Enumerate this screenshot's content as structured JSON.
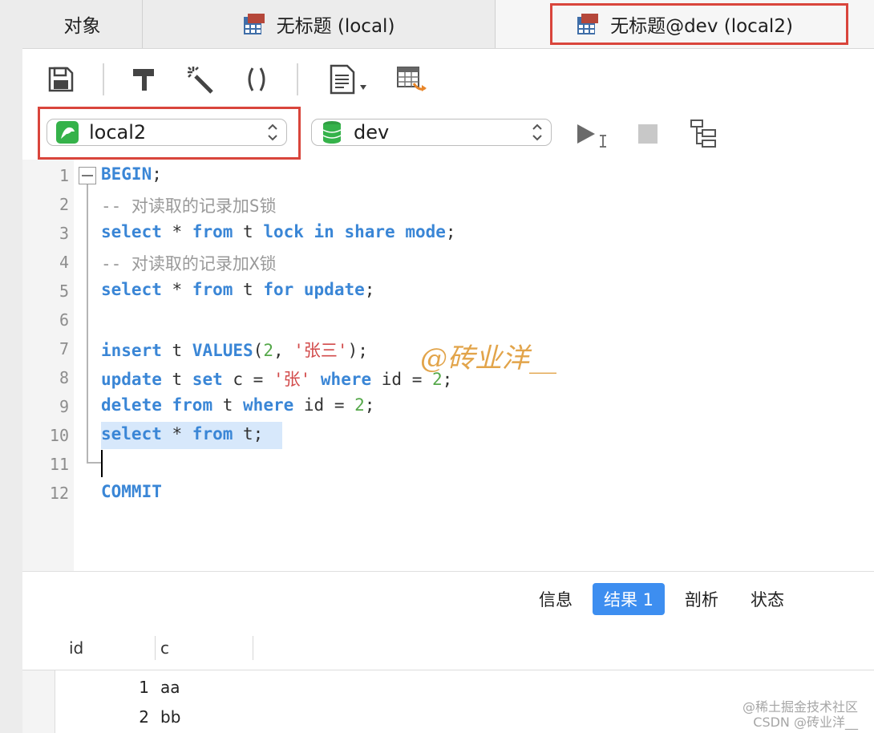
{
  "tabs": {
    "objects": "对象",
    "tab1": "无标题 (local)",
    "tab2": "无标题@dev (local2)"
  },
  "toolbar": {
    "icons": [
      "save-icon",
      "format-hammer-icon",
      "beautify-wand-icon",
      "parentheses-icon",
      "snippet-document-icon",
      "table-export-icon"
    ]
  },
  "connection": {
    "selected": "local2",
    "database": "dev",
    "icons": [
      "run-icon",
      "stop-icon",
      "explain-plan-icon"
    ]
  },
  "editor": {
    "line_numbers": [
      "1",
      "2",
      "3",
      "4",
      "5",
      "6",
      "7",
      "8",
      "9",
      "10",
      "11",
      "12"
    ],
    "lines": [
      {
        "n": "1",
        "tokens": [
          {
            "t": "BEGIN",
            "k": "kw"
          },
          {
            "t": ";",
            "k": "p"
          }
        ]
      },
      {
        "n": "2",
        "tokens": [
          {
            "t": "-- 对读取的记录加S锁",
            "k": "cm"
          }
        ]
      },
      {
        "n": "3",
        "tokens": [
          {
            "t": "select",
            "k": "kw"
          },
          {
            "t": " * ",
            "k": "p"
          },
          {
            "t": "from",
            "k": "kw"
          },
          {
            "t": " t ",
            "k": "p"
          },
          {
            "t": "lock in share mode",
            "k": "kw"
          },
          {
            "t": ";",
            "k": "p"
          }
        ]
      },
      {
        "n": "4",
        "tokens": [
          {
            "t": "-- 对读取的记录加X锁",
            "k": "cm"
          }
        ]
      },
      {
        "n": "5",
        "tokens": [
          {
            "t": "select",
            "k": "kw"
          },
          {
            "t": " * ",
            "k": "p"
          },
          {
            "t": "from",
            "k": "kw"
          },
          {
            "t": " t ",
            "k": "p"
          },
          {
            "t": "for update",
            "k": "kw"
          },
          {
            "t": ";",
            "k": "p"
          }
        ]
      },
      {
        "n": "6",
        "tokens": []
      },
      {
        "n": "7",
        "tokens": [
          {
            "t": "insert",
            "k": "kw"
          },
          {
            "t": " t ",
            "k": "p"
          },
          {
            "t": "VALUES",
            "k": "kw"
          },
          {
            "t": "(",
            "k": "p"
          },
          {
            "t": "2",
            "k": "num"
          },
          {
            "t": ", ",
            "k": "p"
          },
          {
            "t": "'张三'",
            "k": "str"
          },
          {
            "t": ");",
            "k": "p"
          }
        ]
      },
      {
        "n": "8",
        "tokens": [
          {
            "t": "update",
            "k": "kw"
          },
          {
            "t": " t ",
            "k": "p"
          },
          {
            "t": "set",
            "k": "kw"
          },
          {
            "t": " c = ",
            "k": "p"
          },
          {
            "t": "'张'",
            "k": "str"
          },
          {
            "t": " ",
            "k": "p"
          },
          {
            "t": "where",
            "k": "kw"
          },
          {
            "t": " id = ",
            "k": "p"
          },
          {
            "t": "2",
            "k": "num"
          },
          {
            "t": ";",
            "k": "p"
          }
        ]
      },
      {
        "n": "9",
        "tokens": [
          {
            "t": "delete",
            "k": "kw"
          },
          {
            "t": " ",
            "k": "p"
          },
          {
            "t": "from",
            "k": "kw"
          },
          {
            "t": " t ",
            "k": "p"
          },
          {
            "t": "where",
            "k": "kw"
          },
          {
            "t": " id = ",
            "k": "p"
          },
          {
            "t": "2",
            "k": "num"
          },
          {
            "t": ";",
            "k": "p"
          }
        ]
      },
      {
        "n": "10",
        "tokens": [
          {
            "t": "select",
            "k": "kw"
          },
          {
            "t": " * ",
            "k": "p"
          },
          {
            "t": "from",
            "k": "kw"
          },
          {
            "t": " t;",
            "k": "p"
          }
        ]
      },
      {
        "n": "11",
        "tokens": []
      },
      {
        "n": "12",
        "tokens": [
          {
            "t": "COMMIT",
            "k": "kw"
          }
        ]
      }
    ],
    "watermark": "@砖业洋__"
  },
  "results": {
    "tabs": [
      "信息",
      "结果 1",
      "剖析",
      "状态"
    ],
    "active_tab": "结果 1",
    "columns": [
      "id",
      "c"
    ],
    "rows": [
      [
        "1",
        "aa"
      ],
      [
        "2",
        "bb"
      ]
    ]
  },
  "credits": [
    "@稀土掘金技术社区",
    "CSDN @砖业洋__"
  ],
  "colors": {
    "accent": "#3d8ef0",
    "highlight": "#d9453c",
    "keyword": "#3a86d6",
    "string": "#d24b4b",
    "number": "#55a84a",
    "comment": "#999999"
  }
}
